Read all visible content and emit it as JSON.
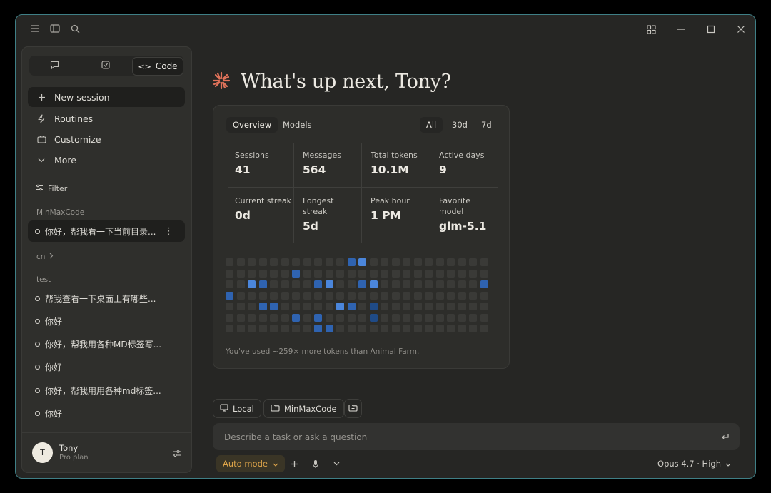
{
  "greeting": "What's up next, Tony?",
  "sidebar": {
    "tabs": [
      {
        "icon": "chat-icon",
        "label": ""
      },
      {
        "icon": "task-icon",
        "label": ""
      },
      {
        "icon": "code-icon",
        "label": "Code"
      }
    ],
    "nav": [
      {
        "icon": "plus-icon",
        "label": "New session"
      },
      {
        "icon": "lightning-icon",
        "label": "Routines"
      },
      {
        "icon": "briefcase-icon",
        "label": "Customize"
      },
      {
        "icon": "chevron-down-icon",
        "label": "More"
      }
    ],
    "filter": "Filter",
    "groups": {
      "minmax": "MinMaxCode",
      "cn": "cn",
      "test": "test"
    },
    "sessions_minmax": [
      "你好，帮我看一下当前目录..."
    ],
    "sessions_test": [
      "帮我查看一下桌面上有哪些...",
      "你好",
      "你好，帮我用各种MD标签写...",
      "你好",
      "你好，帮我用用各种md标签...",
      "你好"
    ],
    "user": {
      "initial": "T",
      "name": "Tony",
      "plan": "Pro plan"
    }
  },
  "stats": {
    "tabs": [
      "Overview",
      "Models"
    ],
    "ranges": [
      "All",
      "30d",
      "7d"
    ],
    "items": [
      {
        "label": "Sessions",
        "value": "41"
      },
      {
        "label": "Messages",
        "value": "564"
      },
      {
        "label": "Total tokens",
        "value": "10.1M"
      },
      {
        "label": "Active days",
        "value": "9"
      },
      {
        "label": "Current streak",
        "value": "0d"
      },
      {
        "label": "Longest streak",
        "value": "5d"
      },
      {
        "label": "Peak hour",
        "value": "1 PM"
      },
      {
        "label": "Favorite model",
        "value": "glm-5.1"
      }
    ],
    "footnote": "You've used ~259× more tokens than Animal Farm.",
    "heatmap": {
      "rows": 7,
      "cols": 24,
      "active": [
        {
          "r": 0,
          "c": 11,
          "level": 2
        },
        {
          "r": 0,
          "c": 12,
          "level": 3
        },
        {
          "r": 1,
          "c": 6,
          "level": 2
        },
        {
          "r": 2,
          "c": 2,
          "level": 3
        },
        {
          "r": 2,
          "c": 3,
          "level": 2
        },
        {
          "r": 2,
          "c": 8,
          "level": 2
        },
        {
          "r": 2,
          "c": 9,
          "level": 3
        },
        {
          "r": 2,
          "c": 12,
          "level": 2
        },
        {
          "r": 2,
          "c": 13,
          "level": 3
        },
        {
          "r": 2,
          "c": 23,
          "level": 2
        },
        {
          "r": 3,
          "c": 0,
          "level": 2
        },
        {
          "r": 4,
          "c": 3,
          "level": 2
        },
        {
          "r": 4,
          "c": 4,
          "level": 2
        },
        {
          "r": 4,
          "c": 10,
          "level": 3
        },
        {
          "r": 4,
          "c": 11,
          "level": 2
        },
        {
          "r": 4,
          "c": 13,
          "level": 1
        },
        {
          "r": 5,
          "c": 6,
          "level": 2
        },
        {
          "r": 5,
          "c": 8,
          "level": 2
        },
        {
          "r": 5,
          "c": 13,
          "level": 1
        },
        {
          "r": 6,
          "c": 8,
          "level": 2
        },
        {
          "r": 6,
          "c": 9,
          "level": 2
        }
      ]
    }
  },
  "composer": {
    "chips": [
      {
        "icon": "monitor-icon",
        "label": "Local"
      },
      {
        "icon": "folder-icon",
        "label": "MinMaxCode"
      }
    ],
    "placeholder": "Describe a task or ask a question",
    "mode": "Auto mode",
    "model": "Opus 4.7 · High"
  },
  "colors": {
    "accent": "#e0725a",
    "mode": "#e0a64a",
    "border": "#3f7f86"
  }
}
